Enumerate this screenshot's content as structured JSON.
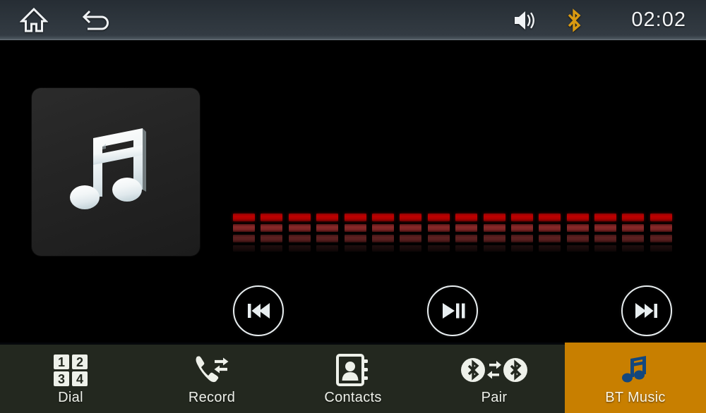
{
  "status_bar": {
    "home_icon": "home-icon",
    "back_icon": "back-arrow-icon",
    "volume_icon": "speaker-volume-icon",
    "bluetooth_icon": "bluetooth-icon",
    "bluetooth_color": "#d99a12",
    "clock": "02:02"
  },
  "player": {
    "album_art_icon": "music-note-icon",
    "prev_label": "prev-track-icon",
    "play_pause_label": "play-pause-icon",
    "next_label": "next-track-icon",
    "equalizer": {
      "columns": 16,
      "levels": [
        3,
        3,
        3,
        3,
        3,
        3,
        3,
        3,
        3,
        3,
        3,
        3,
        3,
        3,
        3,
        3
      ],
      "bar_colors": [
        "#c00000",
        "#8a2a2a",
        "#5e2121",
        "#190b0b"
      ]
    }
  },
  "bottom_nav": {
    "active_color": "#c87f00",
    "items": [
      {
        "label": "Dial",
        "icon": "dialpad-icon",
        "keys": [
          "1",
          "2",
          "3",
          "4"
        ],
        "active": false
      },
      {
        "label": "Record",
        "icon": "call-record-icon",
        "active": false
      },
      {
        "label": "Contacts",
        "icon": "contacts-book-icon",
        "active": false
      },
      {
        "label": "Pair",
        "icon": "bluetooth-pair-icon",
        "active": false
      },
      {
        "label": "BT Music",
        "icon": "bt-music-note-icon",
        "active": true
      }
    ]
  }
}
